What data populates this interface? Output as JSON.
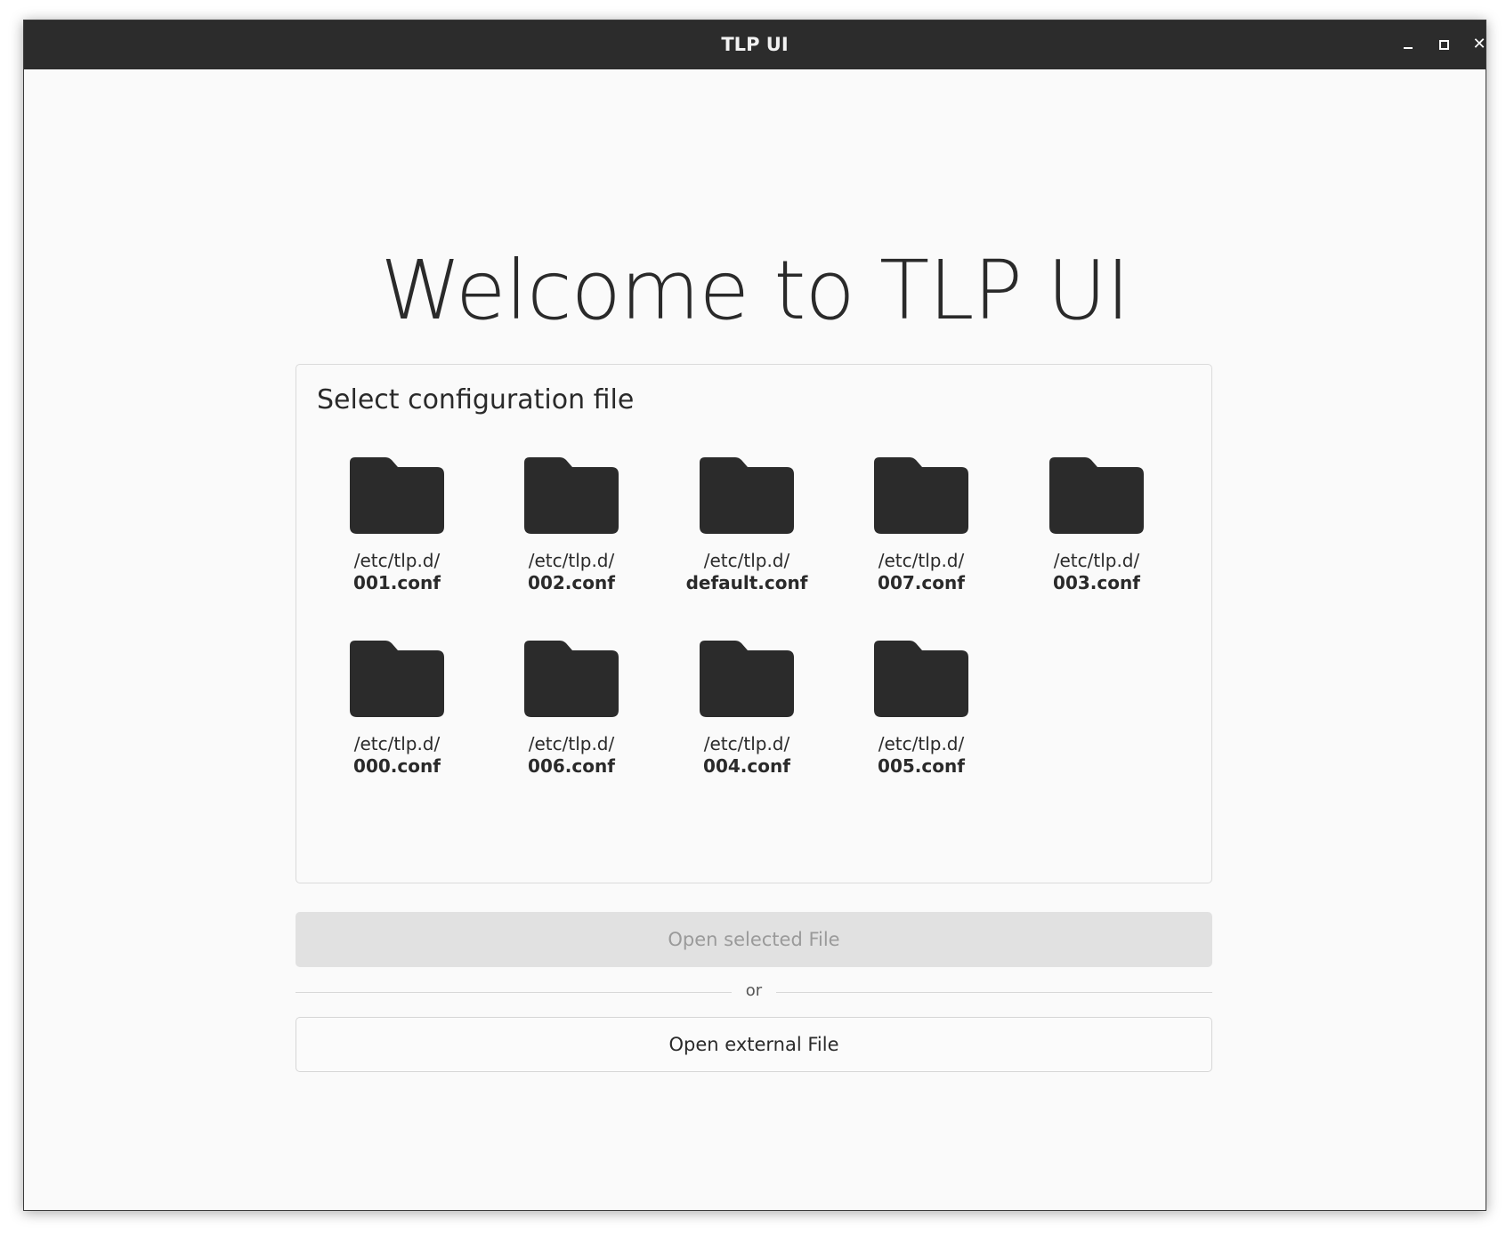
{
  "window": {
    "title": "TLP UI"
  },
  "main": {
    "welcome": "Welcome to TLP UI",
    "panel_title": "Select configuration file",
    "files": [
      {
        "dir": "/etc/tlp.d/",
        "name": "001.conf"
      },
      {
        "dir": "/etc/tlp.d/",
        "name": "002.conf"
      },
      {
        "dir": "/etc/tlp.d/",
        "name": "default.conf"
      },
      {
        "dir": "/etc/tlp.d/",
        "name": "007.conf"
      },
      {
        "dir": "/etc/tlp.d/",
        "name": "003.conf"
      },
      {
        "dir": "/etc/tlp.d/",
        "name": "000.conf"
      },
      {
        "dir": "/etc/tlp.d/",
        "name": "006.conf"
      },
      {
        "dir": "/etc/tlp.d/",
        "name": "004.conf"
      },
      {
        "dir": "/etc/tlp.d/",
        "name": "005.conf"
      }
    ],
    "open_selected_label": "Open selected File",
    "or_label": "or",
    "open_external_label": "Open external File"
  },
  "icons": {
    "file": "folder-icon",
    "minimize": "minimize-icon",
    "maximize": "maximize-icon",
    "close": "close-icon"
  },
  "colors": {
    "titlebar": "#2c2c2c",
    "background": "#fafafa",
    "folder": "#2b2b2b",
    "disabled_button": "#e1e1e1",
    "disabled_text": "#9a9a9a"
  }
}
